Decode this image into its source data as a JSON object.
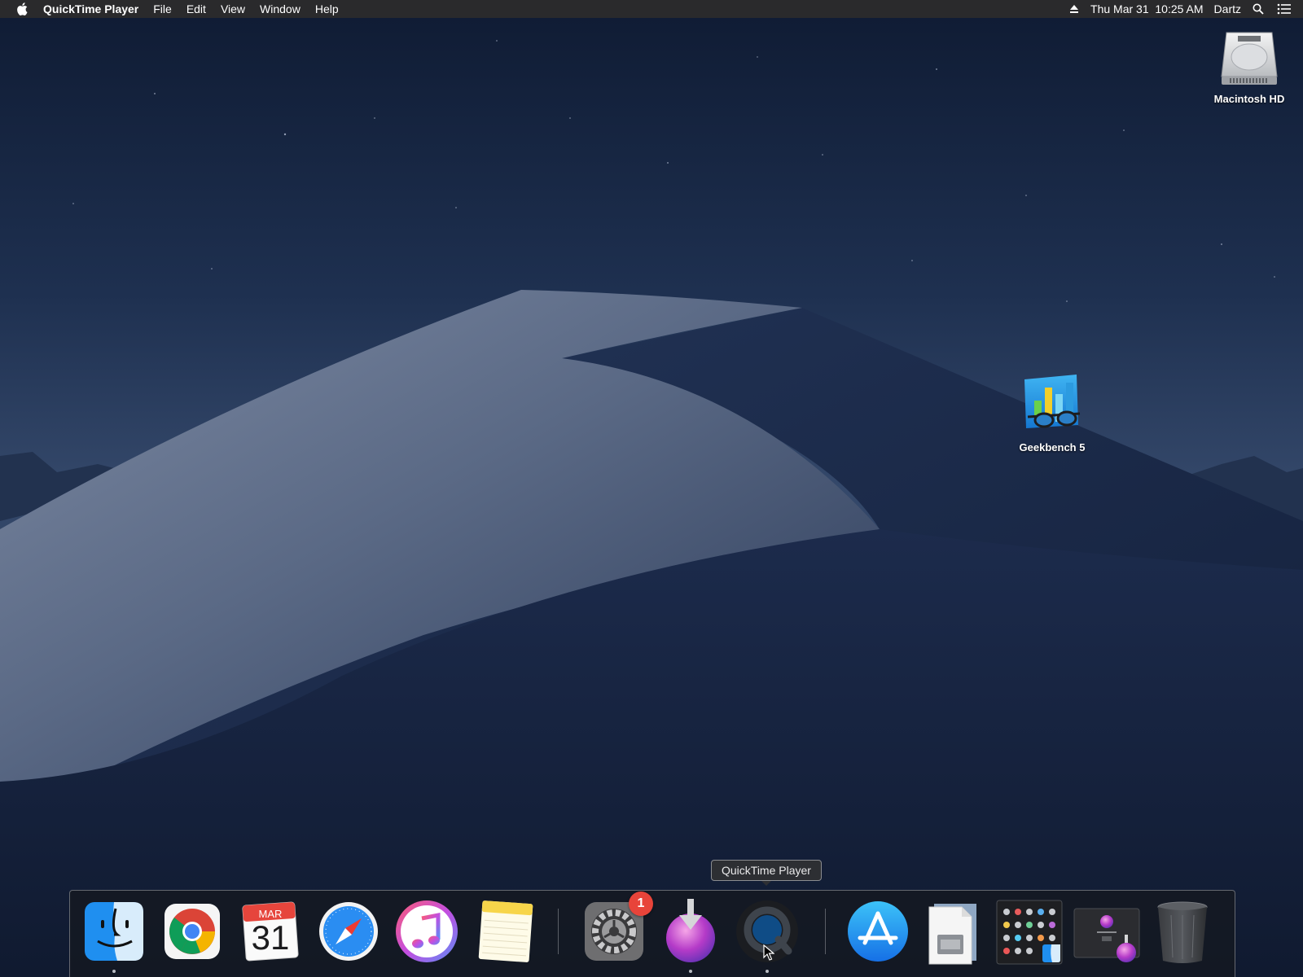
{
  "menubar": {
    "apple_icon": "apple-icon",
    "app_name": "QuickTime Player",
    "menus": [
      "File",
      "Edit",
      "View",
      "Window",
      "Help"
    ],
    "status": {
      "eject_icon": "eject-icon",
      "datetime": "Thu Mar 31  10:25 AM",
      "user": "Dartz",
      "search_icon": "spotlight-search-icon",
      "notification_icon": "notification-center-icon"
    }
  },
  "desktop": {
    "icons": [
      {
        "label": "Macintosh HD",
        "icon": "hard-drive-icon"
      },
      {
        "label": "Geekbench 5",
        "icon": "geekbench-icon"
      }
    ]
  },
  "tooltip": {
    "text": "QuickTime Player"
  },
  "dock": {
    "items": [
      {
        "name": "Finder",
        "icon": "finder-icon",
        "running": true
      },
      {
        "name": "Google Chrome",
        "icon": "chrome-icon",
        "running": false
      },
      {
        "name": "Calendar",
        "icon": "calendar-icon",
        "running": false,
        "month": "MAR",
        "day": "31"
      },
      {
        "name": "Safari",
        "icon": "safari-icon",
        "running": false
      },
      {
        "name": "iTunes",
        "icon": "itunes-icon",
        "running": false
      },
      {
        "name": "Notes",
        "icon": "notes-icon",
        "running": false
      },
      {
        "name": "System Preferences",
        "icon": "system-preferences-icon",
        "running": false,
        "badge": "1"
      },
      {
        "name": "macOS Installer",
        "icon": "installer-icon",
        "running": true
      },
      {
        "name": "QuickTime Player",
        "icon": "quicktime-icon",
        "running": true
      },
      {
        "name": "App Store",
        "icon": "app-store-icon",
        "running": false
      },
      {
        "name": "Document",
        "icon": "document-icon",
        "running": false
      },
      {
        "name": "Applications",
        "icon": "applications-folder-icon",
        "running": false
      },
      {
        "name": "macOS Monterey",
        "icon": "monterey-window-icon",
        "running": false
      },
      {
        "name": "Trash",
        "icon": "trash-icon",
        "running": false
      }
    ]
  }
}
